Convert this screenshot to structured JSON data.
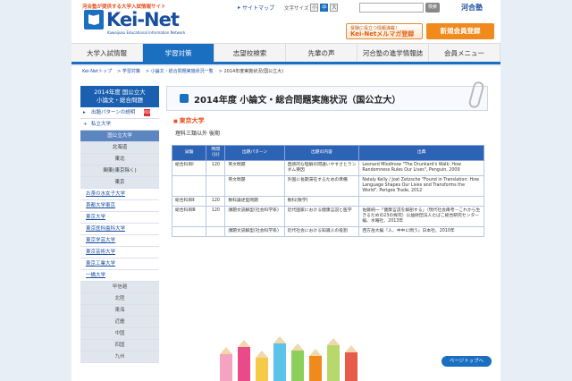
{
  "header": {
    "tagline": "河合塾が提供する大学入試情報サイト",
    "logo_text": "Kei-Net",
    "logo_sub": "Kawaijuku Educational Information Network",
    "sitemap": "サイトマップ",
    "font_size_label": "文字サイズ",
    "font_sizes": [
      "小",
      "中",
      "大"
    ],
    "search_placeholder": "",
    "search_button": "検索",
    "brand": "河合塾",
    "mail_line1": "受験に役立つ情報満載！",
    "mail_line2": "Kei-Netメルマガ登録",
    "register": "新規会員登録"
  },
  "nav": [
    "大学入試情報",
    "学習対策",
    "志望校検索",
    "先輩の声",
    "河合塾の進学情報誌",
    "会員メニュー"
  ],
  "breadcrumb": [
    "Kei-Netトップ",
    "学習対策",
    "小論文・総合問題実施状況一覧",
    "2014年度実施状況(国公立大)"
  ],
  "sidebar": {
    "title_line1": "2014年度 国公立大",
    "title_line2": "小論文・総合問題",
    "pdf_link": "出題パターンの説明",
    "private": "私立大学",
    "public_header": "国公立大学",
    "regions": [
      "北海道",
      "東北",
      "関東(東京除く)",
      "東京"
    ],
    "universities": [
      "お茶の水女子大学",
      "首都大学東京",
      "東京大学",
      "東京医科歯科大学",
      "東京学芸大学",
      "東京芸術大学",
      "東京工業大学",
      "一橋大学"
    ],
    "regions2": [
      "甲信越",
      "北陸",
      "東海",
      "近畿",
      "中国",
      "四国",
      "九州"
    ]
  },
  "main": {
    "title": "2014年度 小論文・総合問題実施状況（国公立大）",
    "university": "東京大学",
    "course": "理科三類以外 後期",
    "table_headers": [
      "試験",
      "時間(分)",
      "出題パターン",
      "出題の内容",
      "出典"
    ],
    "rows": [
      [
        "総合科目Ⅰ",
        "120",
        "英文問題",
        "直感的な理解の間違いやすさとランダム要因",
        "Leonard Mlodinow \"The Drunkard's Walk: How Randomness Rules Our Lives\", Penguin, 2009"
      ],
      [
        "",
        "",
        "英文問題",
        "外国に長期滞在するための準備",
        "Nataly Kelly / Jost Zetzsche \"Found in Translation: How Language Shapes Our Lives and Transforms the World\", Perigee Trade, 2012"
      ],
      [
        "総合科目Ⅱ",
        "120",
        "数科論述型問題",
        "数科(数学)",
        ""
      ],
      [
        "総合科目Ⅲ",
        "120",
        "課題文読解型(社会科学系)",
        "近代国家における健康言説と医学",
        "佐藤純一「健康言説を解剖する」（現代社会再考－これから生きるための23の探究）公益財団法人たばこ総合研究センター 編、水曜社、2013年"
      ],
      [
        "",
        "",
        "課題文読解型(社会科学系)",
        "近代社会における知識人の役割",
        "西方岳大編『人、中中に問う』日本社、2010年"
      ]
    ]
  },
  "pagetop": "ページトップへ",
  "colors": {
    "brand_blue": "#1a6fc0",
    "accent_orange": "#e8501e"
  }
}
